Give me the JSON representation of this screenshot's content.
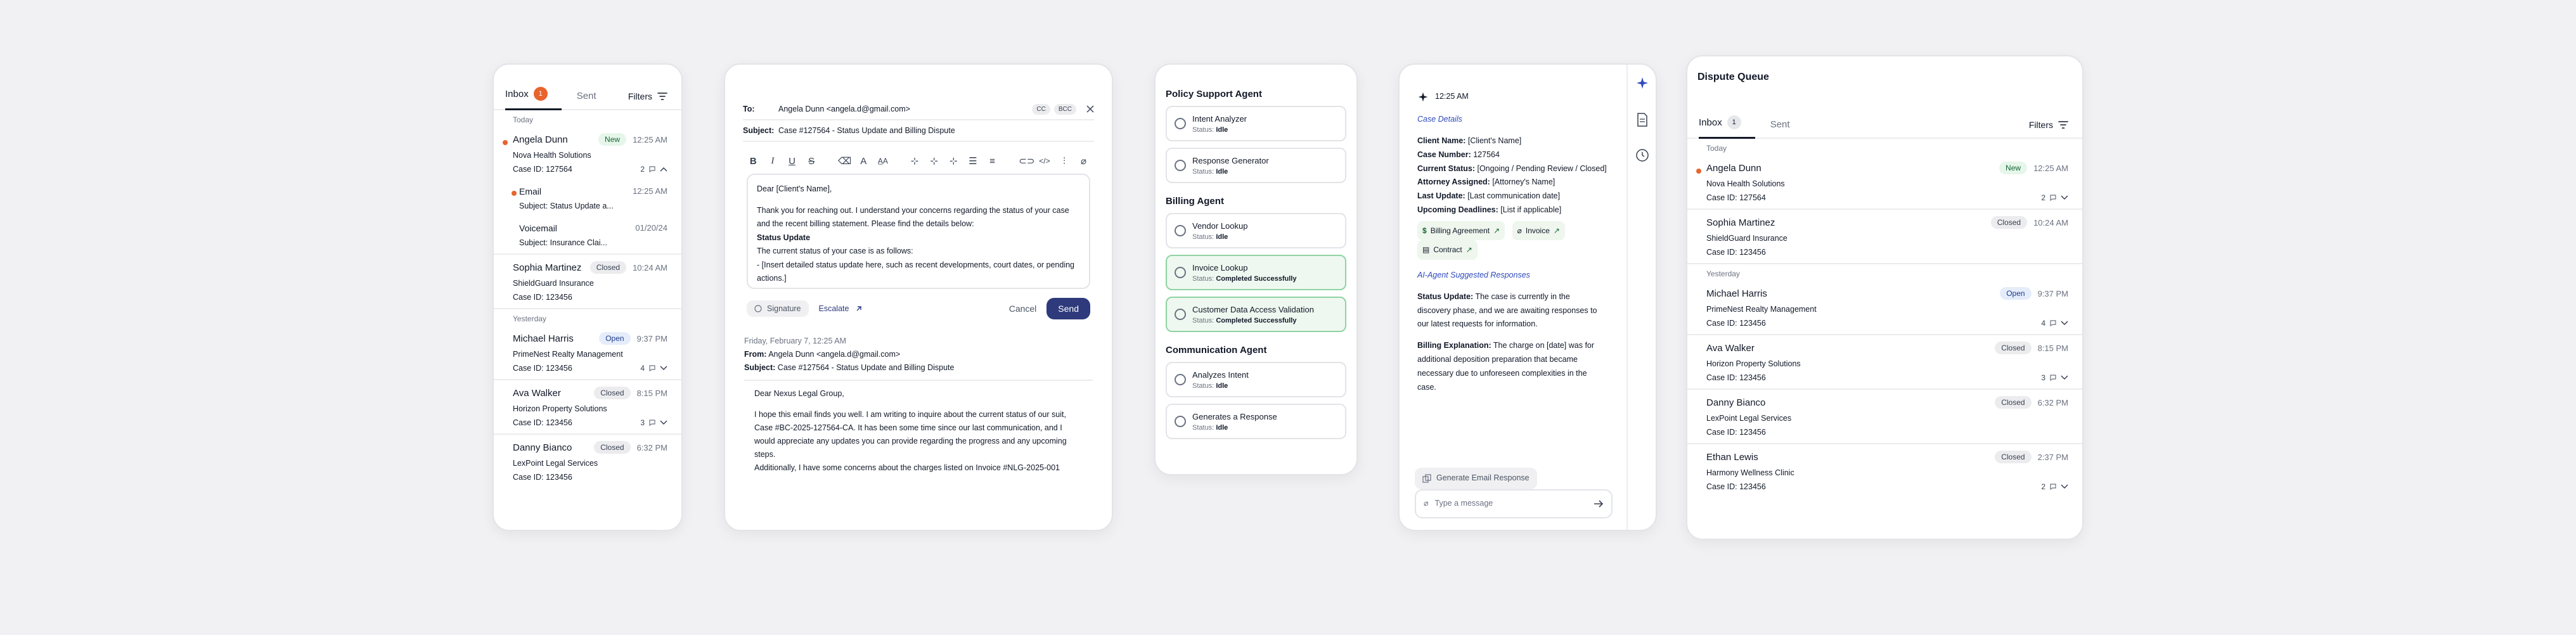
{
  "inbox1": {
    "tab_inbox": "Inbox",
    "tab_inbox_count": "1",
    "tab_sent": "Sent",
    "filters": "Filters",
    "group_today": "Today",
    "group_yesterday": "Yesterday",
    "item1": {
      "name": "Angela Dunn",
      "badge": "New",
      "time": "12:25 AM",
      "company": "Nova Health Solutions",
      "case": "Case ID: 127564",
      "count": "2"
    },
    "sub1": {
      "type": "Email",
      "time": "12:25 AM",
      "subject": "Subject: Status Update a..."
    },
    "sub2": {
      "type": "Voicemail",
      "time": "01/20/24",
      "subject": "Subject: Insurance Clai..."
    },
    "item2": {
      "name": "Sophia Martinez",
      "badge": "Closed",
      "time": "10:24 AM",
      "company": "ShieldGuard Insurance",
      "case": "Case ID: 123456"
    },
    "item3": {
      "name": "Michael Harris",
      "badge": "Open",
      "time": "9:37 PM",
      "company": "PrimeNest Realty Management",
      "case": "Case ID: 123456",
      "count": "4"
    },
    "item4": {
      "name": "Ava Walker",
      "badge": "Closed",
      "time": "8:15 PM",
      "company": "Horizon Property Solutions",
      "case": "Case ID: 123456",
      "count": "3"
    },
    "item5": {
      "name": "Danny Bianco",
      "badge": "Closed",
      "time": "6:32 PM",
      "company": "LexPoint Legal Services",
      "case": "Case ID: 123456"
    }
  },
  "mail": {
    "to_label": "To:",
    "to_value": "Angela Dunn <angela.d@gmail.com>",
    "cc": "CC",
    "bcc": "BCC",
    "subject_label": "Subject:",
    "subject_value": "Case #127564 - Status Update and Billing Dispute",
    "body": [
      "Dear [Client's Name],",
      "",
      "Thank you for reaching out. I understand your concerns regarding the status of your case",
      "and the recent billing statement. Please find the details below:",
      "Status Update",
      "The current status of your case is as follows:",
      "- [Insert detailed status update here, such as recent developments, court dates, or pending",
      "actions.]"
    ],
    "signature": "Signature",
    "escalate": "Escalate",
    "cancel": "Cancel",
    "send": "Send",
    "thread_date": "Friday, February 7, 12:25 AM",
    "thread_from_label": "From:",
    "thread_from": "Angela Dunn <angela.d@gmail.com>",
    "thread_subject_label": "Subject:",
    "thread_subject": "Case #127564 - Status Update and Billing Dispute",
    "thread_body": [
      "Dear Nexus Legal Group,",
      "",
      "I hope this email finds you well. I am writing to inquire about the current status of our suit,",
      "Case #BC-2025-127564-CA. It has been some time since our last communication, and I",
      "would appreciate any updates you can provide regarding the progress and any upcoming",
      "steps.",
      "Additionally, I have some concerns about the charges listed on Invoice #NLG-2025-001"
    ]
  },
  "agents": {
    "policy_title": "Policy Support Agent",
    "policy": [
      {
        "name": "Intent Analyzer",
        "status_label": "Status:",
        "status": "Idle"
      },
      {
        "name": "Response Generator",
        "status_label": "Status:",
        "status": "Idle"
      }
    ],
    "billing_title": "Billing Agent",
    "billing": [
      {
        "name": "Vendor Lookup",
        "status_label": "Status:",
        "status": "Idle"
      },
      {
        "name": "Invoice Lookup",
        "status_label": "Status:",
        "status": "Completed Successfully"
      },
      {
        "name": "Customer Data Access Validation",
        "status_label": "Status:",
        "status": "Completed Successfully"
      }
    ],
    "comm_title": "Communication Agent",
    "comm": [
      {
        "name": "Analyzes Intent",
        "status_label": "Status:",
        "status": "Idle"
      },
      {
        "name": "Generates a Response",
        "status_label": "Status:",
        "status": "Idle"
      }
    ]
  },
  "ai": {
    "time": "12:25 AM",
    "case_details": "Case Details",
    "client_label": "Client Name:",
    "client": "[Client's Name]",
    "case_label": "Case Number:",
    "case": "127564",
    "status_label": "Current Status:",
    "status": "[Ongoing / Pending Review / Closed]",
    "attorney_label": "Attorney Assigned:",
    "attorney": "[Attorney's Name]",
    "update_label": "Last Update:",
    "update": "[Last communication date]",
    "deadline_label": "Upcoming Deadlines:",
    "deadline": "[List if applicable]",
    "chip1": "Billing Agreement",
    "chip2": "Invoice",
    "chip3": "Contract",
    "suggested": "AI-Agent Suggested Responses",
    "su_label": "Status Update:",
    "su_text": [
      "The case is currently in the",
      "discovery phase, and we are awaiting responses to",
      "our latest requests for information."
    ],
    "be_label": "Billing Explanation:",
    "be_text": [
      "The charge on [date] was for",
      "additional deposition preparation that became",
      "necessary due to unforeseen complexities in the",
      "case."
    ],
    "generate": "Generate Email Response",
    "placeholder": "Type a message"
  },
  "queue": {
    "title": "Dispute Queue",
    "tab_inbox": "Inbox",
    "tab_inbox_count": "1",
    "tab_sent": "Sent",
    "filters": "Filters",
    "group_today": "Today",
    "group_yesterday": "Yesterday",
    "item1": {
      "name": "Angela Dunn",
      "badge": "New",
      "time": "12:25 AM",
      "company": "Nova Health Solutions",
      "case": "Case ID: 127564",
      "count": "2"
    },
    "item2": {
      "name": "Sophia Martinez",
      "badge": "Closed",
      "time": "10:24 AM",
      "company": "ShieldGuard Insurance",
      "case": "Case ID: 123456"
    },
    "item3": {
      "name": "Michael Harris",
      "badge": "Open",
      "time": "9:37 PM",
      "company": "PrimeNest Realty Management",
      "case": "Case ID: 123456",
      "count": "4"
    },
    "item4": {
      "name": "Ava Walker",
      "badge": "Closed",
      "time": "8:15 PM",
      "company": "Horizon Property Solutions",
      "case": "Case ID: 123456",
      "count": "3"
    },
    "item5": {
      "name": "Danny Bianco",
      "badge": "Closed",
      "time": "6:32 PM",
      "company": "LexPoint Legal Services",
      "case": "Case ID: 123456"
    },
    "item6": {
      "name": "Ethan Lewis",
      "badge": "Closed",
      "time": "2:37 PM",
      "company": "Harmony Wellness Clinic",
      "case": "Case ID: 123456",
      "count": "2"
    }
  },
  "colors": {
    "accent": "#e8642c",
    "primary": "#2e3a7c",
    "link": "#2f4bbd",
    "success_bg": "#eef8f0",
    "success_border": "#8fd3a2"
  }
}
